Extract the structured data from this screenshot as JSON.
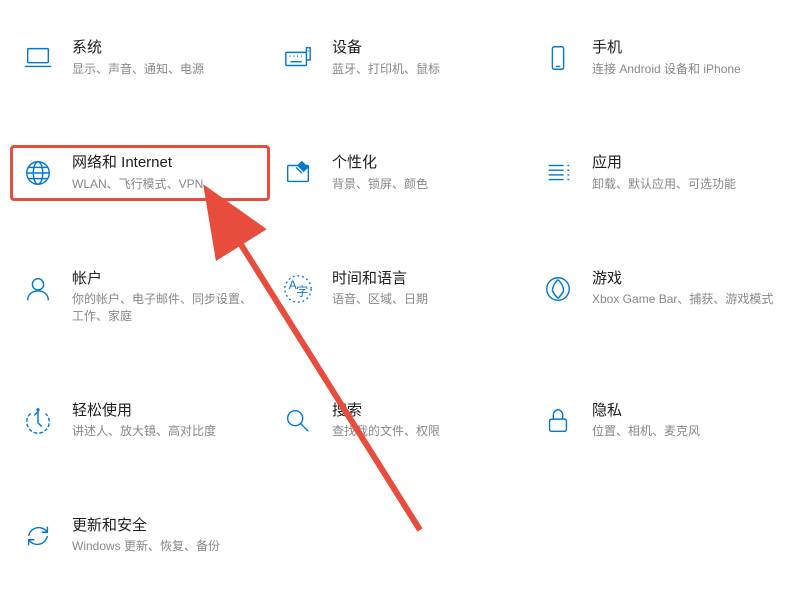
{
  "colors": {
    "accent": "#0078d4",
    "highlight": "#e74c3c",
    "text": "#202020",
    "desc": "#888888"
  },
  "items": [
    {
      "title": "系统",
      "desc": "显示、声音、通知、电源",
      "icon": "laptop-icon"
    },
    {
      "title": "设备",
      "desc": "蓝牙、打印机、鼠标",
      "icon": "keyboard-icon"
    },
    {
      "title": "手机",
      "desc": "连接 Android 设备和 iPhone",
      "icon": "phone-icon"
    },
    {
      "title": "网络和 Internet",
      "desc": "WLAN、飞行模式、VPN",
      "icon": "globe-icon",
      "highlighted": true
    },
    {
      "title": "个性化",
      "desc": "背景、锁屏、颜色",
      "icon": "personalization-icon"
    },
    {
      "title": "应用",
      "desc": "卸载、默认应用、可选功能",
      "icon": "apps-icon"
    },
    {
      "title": "帐户",
      "desc": "你的帐户、电子邮件、同步设置、工作、家庭",
      "icon": "account-icon"
    },
    {
      "title": "时间和语言",
      "desc": "语音、区域、日期",
      "icon": "language-icon"
    },
    {
      "title": "游戏",
      "desc": "Xbox Game Bar、捕获、游戏模式",
      "icon": "gaming-icon"
    },
    {
      "title": "轻松使用",
      "desc": "讲述人、放大镜、高对比度",
      "icon": "accessibility-icon"
    },
    {
      "title": "搜索",
      "desc": "查找我的文件、权限",
      "icon": "search-icon"
    },
    {
      "title": "隐私",
      "desc": "位置、相机、麦克风",
      "icon": "privacy-icon"
    },
    {
      "title": "更新和安全",
      "desc": "Windows 更新、恢复、备份",
      "icon": "update-icon"
    }
  ]
}
